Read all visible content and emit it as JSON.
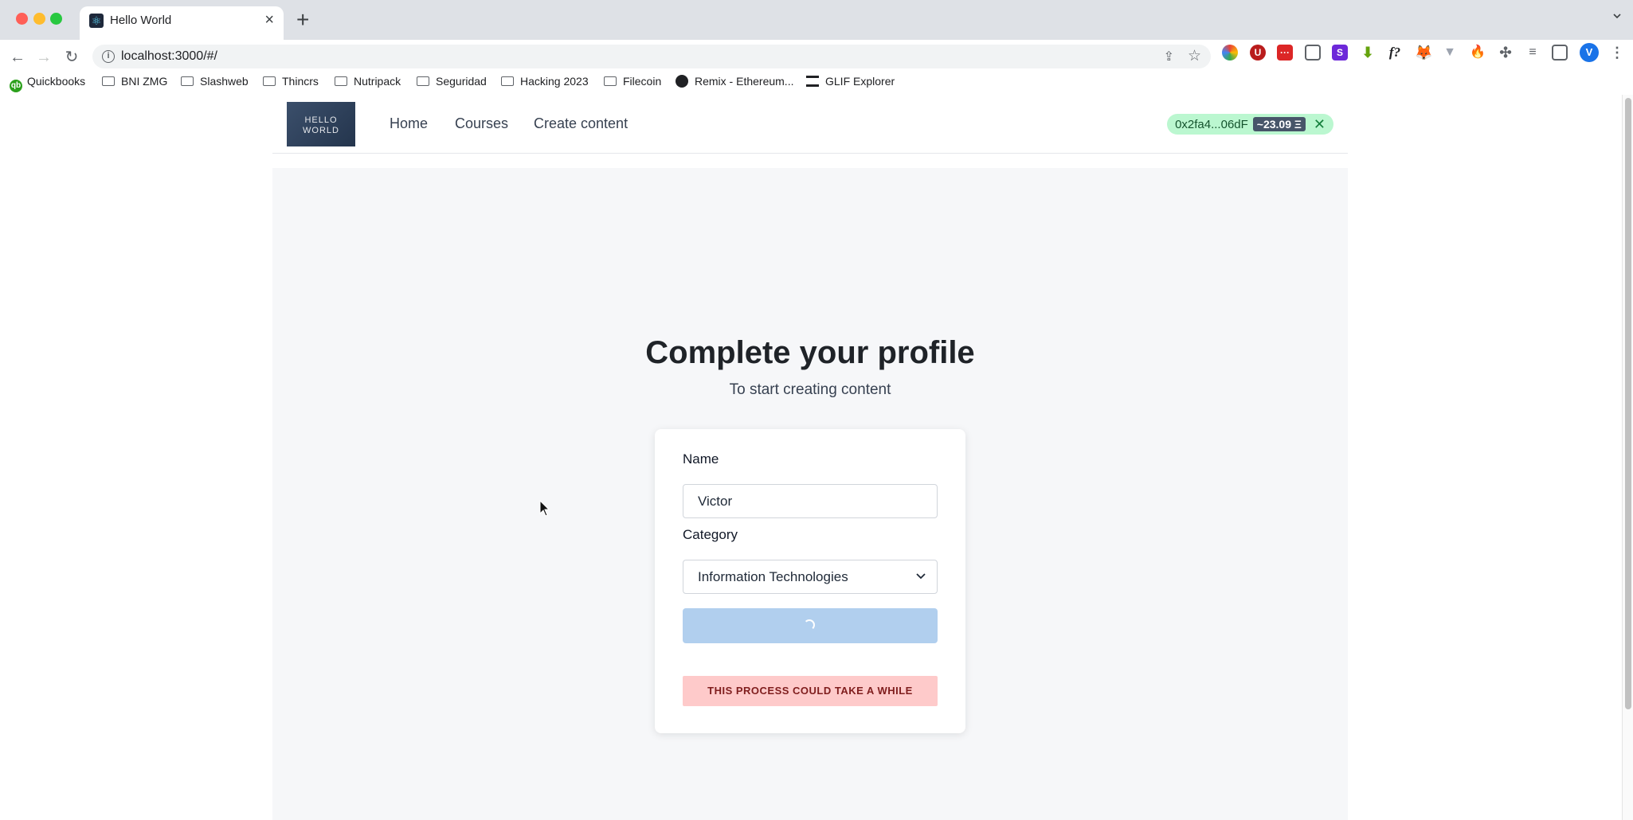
{
  "browser": {
    "tab_title": "Hello World",
    "new_tab_label": "+",
    "url": "localhost:3000/#/",
    "bookmarks": [
      {
        "label": "Quickbooks",
        "icon": "quickbooks-icon"
      },
      {
        "label": "BNI ZMG",
        "icon": "folder-icon"
      },
      {
        "label": "Slashweb",
        "icon": "folder-icon"
      },
      {
        "label": "Thincrs",
        "icon": "folder-icon"
      },
      {
        "label": "Nutripack",
        "icon": "folder-icon"
      },
      {
        "label": "Seguridad",
        "icon": "folder-icon"
      },
      {
        "label": "Hacking 2023",
        "icon": "folder-icon"
      },
      {
        "label": "Filecoin",
        "icon": "folder-icon"
      },
      {
        "label": "Remix - Ethereum...",
        "icon": "remix-icon"
      },
      {
        "label": "GLIF Explorer",
        "icon": "glif-icon"
      }
    ],
    "profile_initial": "V"
  },
  "header": {
    "logo_text": "HELLO WORLD",
    "nav": [
      "Home",
      "Courses",
      "Create content"
    ],
    "wallet_address": "0x2fa4...06dF",
    "wallet_balance": "~23.09 Ξ",
    "wallet_close": "✕"
  },
  "main": {
    "title": "Complete your profile",
    "subtitle": "To start creating content"
  },
  "form": {
    "name_label": "Name",
    "name_value": "Victor",
    "category_label": "Category",
    "category_value": "Information Technologies",
    "notice": "THIS PROCESS COULD TAKE A WHILE"
  },
  "colors": {
    "wallet_bg": "#bbf7d0",
    "button_loading": "#b1cfee",
    "notice_bg": "#fecaca",
    "notice_text": "#7f1d1d"
  }
}
